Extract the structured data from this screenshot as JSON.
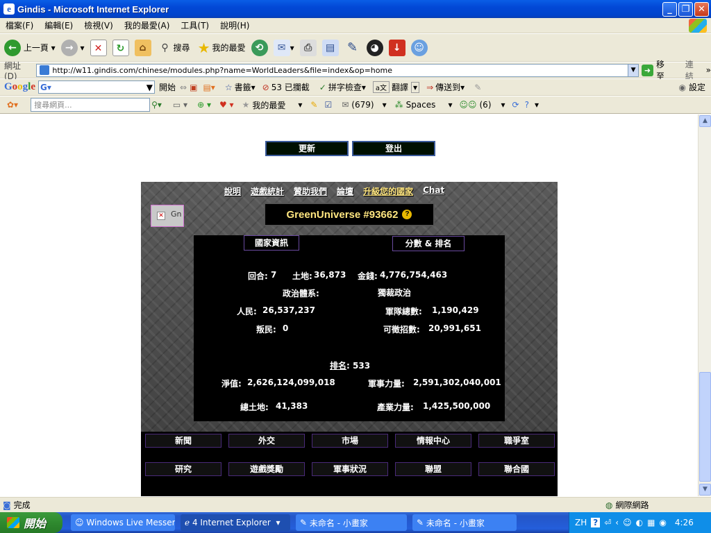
{
  "window": {
    "title": "Gindis - Microsoft Internet Explorer"
  },
  "menu": [
    "檔案(F)",
    "編輯(E)",
    "檢視(V)",
    "我的最愛(A)",
    "工具(T)",
    "說明(H)"
  ],
  "toolbar": {
    "back": "上一頁",
    "search": "搜尋",
    "favorites": "我的最愛"
  },
  "address": {
    "label": "網址(D)",
    "url": "http://w11.gindis.com/chinese/modules.php?name=WorldLeaders&file=index&op=home",
    "go": "移至",
    "links": "連結"
  },
  "google": {
    "logo": "Google",
    "start": "開始",
    "bookmarks": "書籤",
    "blocked": "53 已攔截",
    "spell": "拼字檢查",
    "translate": "翻譯",
    "send": "傳送到",
    "settings": "設定"
  },
  "live": {
    "search_placeholder": "搜尋網頁...",
    "favorites": "我的最愛",
    "mail": "(679)",
    "spaces": "Spaces",
    "contacts": "(6)"
  },
  "page": {
    "refresh": "更新",
    "logout": "登出",
    "topnav": [
      "說明",
      "遊戲統計",
      "贊助我們",
      "論壇",
      "升級您的國家",
      "Chat"
    ],
    "flag_alt": "Gn",
    "country_name": "GreenUniverse #93662",
    "help_icon": "?",
    "tab_info": "國家資訊",
    "tab_score": "分數 & 排名",
    "turn_label": "回合:",
    "turn": "7",
    "land_label": "土地:",
    "land": "36,873",
    "money_label": "金錢:",
    "money": "4,776,754,463",
    "gov_label": "政治體系:",
    "gov": "獨裁政治",
    "pop_label": "人民:",
    "pop": "26,537,237",
    "army_label": "軍隊總數:",
    "army": "1,190,429",
    "rebels_label": "叛民:",
    "rebels": "0",
    "draftable_label": "可徵招數:",
    "draftable": "20,991,651",
    "rank_label": "排名",
    "rank": ": 533",
    "networth_label": "淨值:",
    "networth": "2,626,124,099,018",
    "mil_label": "軍事力量:",
    "mil": "2,591,302,040,001",
    "totalland_label": "總土地:",
    "totalland": "41,383",
    "ind_label": "產業力量:",
    "ind": "1,425,500,000",
    "bottom_row1": [
      "新聞",
      "外交",
      "市場",
      "情報中心",
      "職爭室"
    ],
    "bottom_row2": [
      "研究",
      "遊戲獎勵",
      "軍事狀況",
      "聯盟",
      "聯合國"
    ]
  },
  "status": {
    "text": "完成",
    "zone": "網際網路"
  },
  "taskbar": {
    "start": "開始",
    "tasks": [
      "Windows Live Messen...",
      "4 Internet Explorer",
      "未命名 - 小畫家",
      "未命名 - 小畫家"
    ],
    "lang": "ZH",
    "time": "4:26"
  }
}
